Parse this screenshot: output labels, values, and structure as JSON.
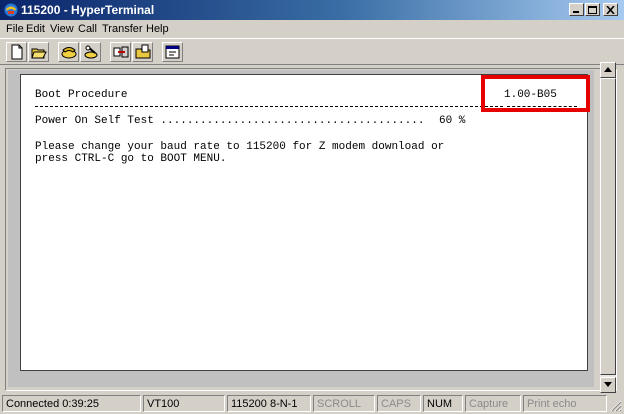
{
  "window": {
    "title": "115200 - HyperTerminal"
  },
  "menu": [
    "File",
    "Edit",
    "View",
    "Call",
    "Transfer",
    "Help"
  ],
  "toolbar": {
    "buttons": [
      "new-icon",
      "open-icon",
      "phone-icon",
      "hangup-icon",
      "send-icon",
      "receive-icon",
      "properties-icon"
    ]
  },
  "terminal": {
    "header_label": "Boot Procedure",
    "version": "1.00-B05",
    "post_line": "Power On Self Test ........................................",
    "post_percent": "60 %",
    "message_line1": "Please change your baud rate to 115200 for Z modem download or",
    "message_line2": "press CTRL-C go to BOOT MENU."
  },
  "status": {
    "connected": "Connected 0:39:25",
    "emulation": "VT100",
    "settings": "115200 8-N-1",
    "scroll": "SCROLL",
    "caps": "CAPS",
    "num": "NUM",
    "capture": "Capture",
    "print_echo": "Print echo"
  },
  "colors": {
    "highlight": "#e60000",
    "titlebar_start": "#0a246a",
    "titlebar_end": "#a6caf0"
  }
}
